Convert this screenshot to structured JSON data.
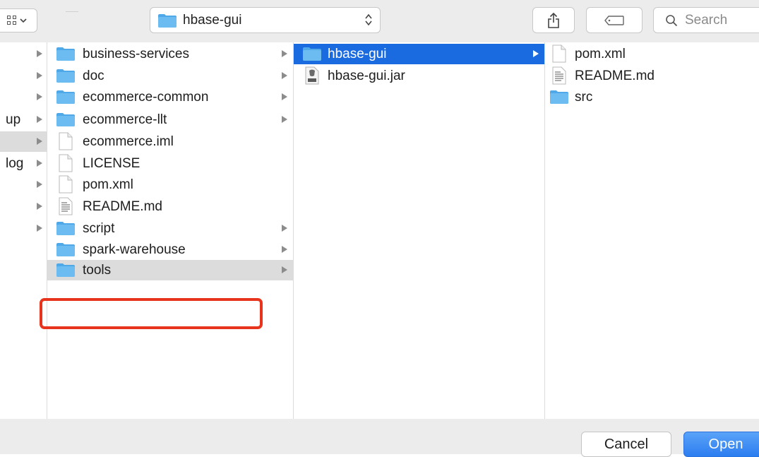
{
  "toolbar": {
    "path_label": "hbase-gui",
    "search_placeholder": "Search"
  },
  "sidebar": {
    "items": [
      {
        "label": "",
        "arrow": true,
        "selected": false
      },
      {
        "label": "",
        "arrow": true,
        "selected": false
      },
      {
        "label": "",
        "arrow": true,
        "selected": false
      },
      {
        "label": "up",
        "arrow": true,
        "selected": false
      },
      {
        "label": "",
        "arrow": true,
        "selected": true
      },
      {
        "label": "log",
        "arrow": true,
        "selected": false
      },
      {
        "label": "",
        "arrow": true,
        "selected": false
      },
      {
        "label": "",
        "arrow": true,
        "selected": false
      },
      {
        "label": "",
        "arrow": true,
        "selected": false
      }
    ]
  },
  "column1": {
    "items": [
      {
        "name": "business-services",
        "icon": "folder-icon",
        "arrow": true
      },
      {
        "name": "doc",
        "icon": "folder-icon",
        "arrow": true
      },
      {
        "name": "ecommerce-common",
        "icon": "folder-icon",
        "arrow": true
      },
      {
        "name": "ecommerce-llt",
        "icon": "folder-icon",
        "arrow": true
      },
      {
        "name": "ecommerce.iml",
        "icon": "file-icon",
        "arrow": false
      },
      {
        "name": "LICENSE",
        "icon": "file-icon",
        "arrow": false
      },
      {
        "name": "pom.xml",
        "icon": "file-icon",
        "arrow": false
      },
      {
        "name": "README.md",
        "icon": "text-file-icon",
        "arrow": false
      },
      {
        "name": "script",
        "icon": "folder-icon",
        "arrow": true
      },
      {
        "name": "spark-warehouse",
        "icon": "folder-icon",
        "arrow": true
      },
      {
        "name": "tools",
        "icon": "folder-icon",
        "arrow": true,
        "selected": true
      }
    ]
  },
  "column2": {
    "items": [
      {
        "name": "hbase-gui",
        "icon": "folder-icon",
        "arrow": true,
        "selected": true
      },
      {
        "name": "hbase-gui.jar",
        "icon": "jar-file-icon",
        "arrow": false
      }
    ]
  },
  "column3": {
    "items": [
      {
        "name": "pom.xml",
        "icon": "file-icon"
      },
      {
        "name": "README.md",
        "icon": "text-file-icon"
      },
      {
        "name": "src",
        "icon": "folder-icon"
      }
    ]
  },
  "footer": {
    "cancel_label": "Cancel",
    "open_label": "Open"
  },
  "colors": {
    "selection_blue": "#1a6ae0",
    "highlight_red": "#e8341c",
    "folder_blue": "#4fa8e8"
  }
}
